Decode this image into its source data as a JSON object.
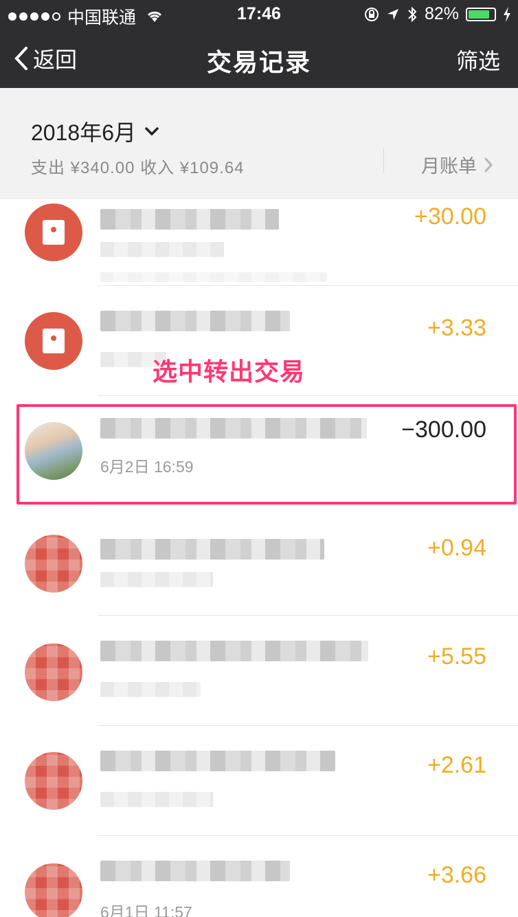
{
  "status_bar": {
    "carrier": "中国联通",
    "time": "17:46",
    "battery": "82%",
    "battery_level": 0.82,
    "icons": [
      "signal-dots",
      "wifi-icon",
      "lock-rotation-icon",
      "location-icon",
      "bluetooth-icon",
      "battery-icon",
      "charging-icon"
    ]
  },
  "nav": {
    "back": "返回",
    "title": "交易记录",
    "filter": "筛选"
  },
  "summary": {
    "month": "2018年6月",
    "totals": "支出 ¥340.00 收入 ¥109.64",
    "bill_link": "月账单"
  },
  "transactions": [
    {
      "amount": "+30.00",
      "type": "income",
      "icon": "red-packet-icon"
    },
    {
      "amount": "+3.33",
      "type": "income",
      "icon": "red-packet-icon"
    },
    {
      "amount": "−300.00",
      "type": "expense",
      "icon": "user-avatar",
      "date": "6月2日 16:59"
    },
    {
      "amount": "+0.94",
      "type": "income",
      "icon": "red-packet-icon"
    },
    {
      "amount": "+5.55",
      "type": "income",
      "icon": "red-packet-icon"
    },
    {
      "amount": "+2.61",
      "type": "income",
      "icon": "red-packet-icon"
    },
    {
      "amount": "+3.66",
      "type": "income",
      "icon": "red-packet-icon",
      "date": "6月1日 11:57"
    }
  ],
  "annotation": "选中转出交易",
  "colors": {
    "nav_bg": "#2e2e31",
    "income": "#f0ad25",
    "expense": "#222222",
    "red_packet": "#dd5a48",
    "highlight": "#ff3872"
  }
}
